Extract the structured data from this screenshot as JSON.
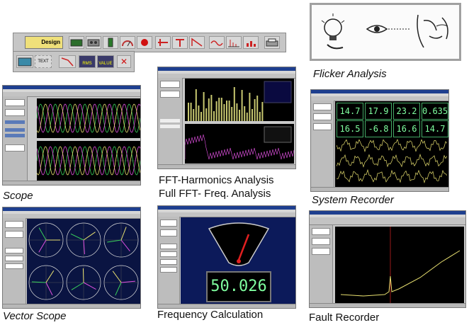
{
  "toolbar": {
    "design_label": "Design",
    "text_label": "TEXT",
    "rms_label": "RMS",
    "value_label": "VALUE",
    "close_glyph": "✕"
  },
  "captions": {
    "flicker": "Flicker Analysis",
    "scope": "Scope",
    "fft_line1": "FFT-Harmonics Analysis",
    "fft_line2": "Full FFT- Freq. Analysis",
    "system": "System Recorder",
    "vector": "Vector Scope",
    "frequency": "Frequency Calculation",
    "fault": "Fault Recorder"
  },
  "system_recorder": {
    "readings_row1": [
      "14.7",
      "17.9",
      "23.2",
      "0.635"
    ],
    "readings_row2": [
      "16.5",
      "-6.8",
      "16.6",
      "14.7"
    ]
  },
  "frequency_calc": {
    "value": "50.026"
  },
  "colors": {
    "lcd_green": "#7fff9f",
    "trace_yellow": "#e8e070",
    "trace_green": "#39d05a",
    "trace_magenta": "#e050e0",
    "needle_red": "#e02020",
    "stop_red": "#d01010"
  },
  "icons": {
    "flicker_bulb": "light-bulb-icon",
    "flicker_eye": "eye-icon",
    "flicker_face": "face-icon"
  }
}
